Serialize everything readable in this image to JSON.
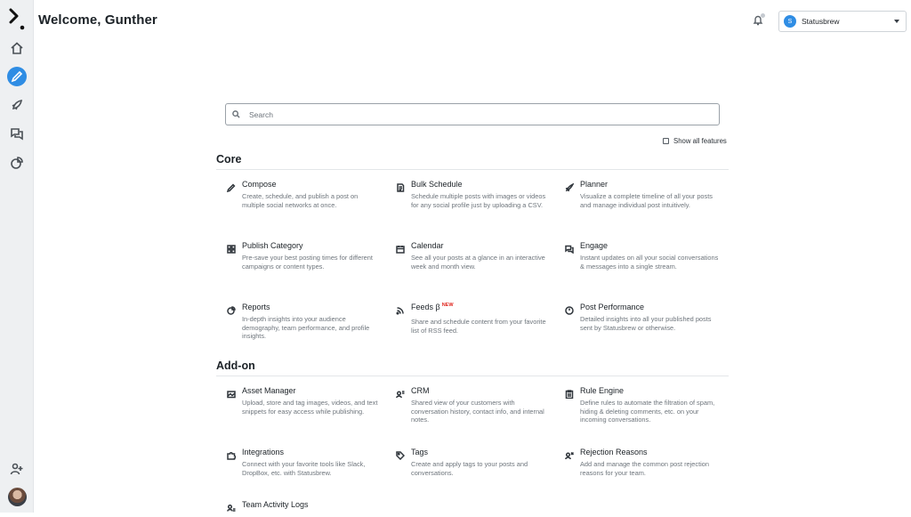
{
  "header": {
    "title": "Welcome, Gunther"
  },
  "account": {
    "initial": "S",
    "name": "Statusbrew"
  },
  "search": {
    "placeholder": "Search"
  },
  "show_all": {
    "label": "Show all features"
  },
  "sections": {
    "core": {
      "title": "Core"
    },
    "addon": {
      "title": "Add-on"
    }
  },
  "features": {
    "compose": {
      "title": "Compose",
      "desc": "Create, schedule, and publish a post on multiple social networks at once."
    },
    "bulk_schedule": {
      "title": "Bulk Schedule",
      "desc": "Schedule multiple posts with images or videos for any social profile just by uploading a CSV."
    },
    "planner": {
      "title": "Planner",
      "desc": "Visualize a complete timeline of all your posts and manage individual post intuitively."
    },
    "publish_category": {
      "title": "Publish Category",
      "desc": "Pre-save your best posting times for different campaigns or content types."
    },
    "calendar": {
      "title": "Calendar",
      "desc": "See all your posts at a glance in an interactive week and month view."
    },
    "engage": {
      "title": "Engage",
      "desc": "Instant updates on all your social conversations & messages into a single stream."
    },
    "reports": {
      "title": "Reports",
      "desc": "In-depth insights into your audience demography, team performance, and profile insights."
    },
    "feeds": {
      "title": "Feeds β",
      "badge": "NEW",
      "desc": "Share and schedule content from your favorite list of RSS feed."
    },
    "post_performance": {
      "title": "Post Performance",
      "desc": "Detailed insights into all your published posts sent by Statusbrew or otherwise."
    },
    "asset_manager": {
      "title": "Asset Manager",
      "desc": "Upload, store and tag images, videos, and text snippets for easy access while publishing."
    },
    "crm": {
      "title": "CRM",
      "desc": "Shared view of your customers with conversation history, contact info, and internal notes."
    },
    "rule_engine": {
      "title": "Rule Engine",
      "desc": "Define rules to automate the filtration of spam, hiding & deleting comments, etc. on your incoming conversations."
    },
    "integrations": {
      "title": "Integrations",
      "desc": "Connect with your favorite tools like Slack, DropBox, etc. with Statusbrew."
    },
    "tags": {
      "title": "Tags",
      "desc": "Create and apply tags to your posts and conversations."
    },
    "rejection_reasons": {
      "title": "Rejection Reasons",
      "desc": "Add and manage the common post rejection reasons for your team."
    },
    "team_activity_logs": {
      "title": "Team Activity Logs",
      "desc": ""
    }
  },
  "colors": {
    "accent": "#2f8de4",
    "new_badge": "#e0271f",
    "sidebar_bg": "#eef0f2"
  },
  "icons": {
    "sidebar": [
      "home-icon",
      "compose-icon",
      "rocket-icon",
      "chat-icon",
      "reports-icon",
      "add-user-icon",
      "avatar"
    ]
  }
}
